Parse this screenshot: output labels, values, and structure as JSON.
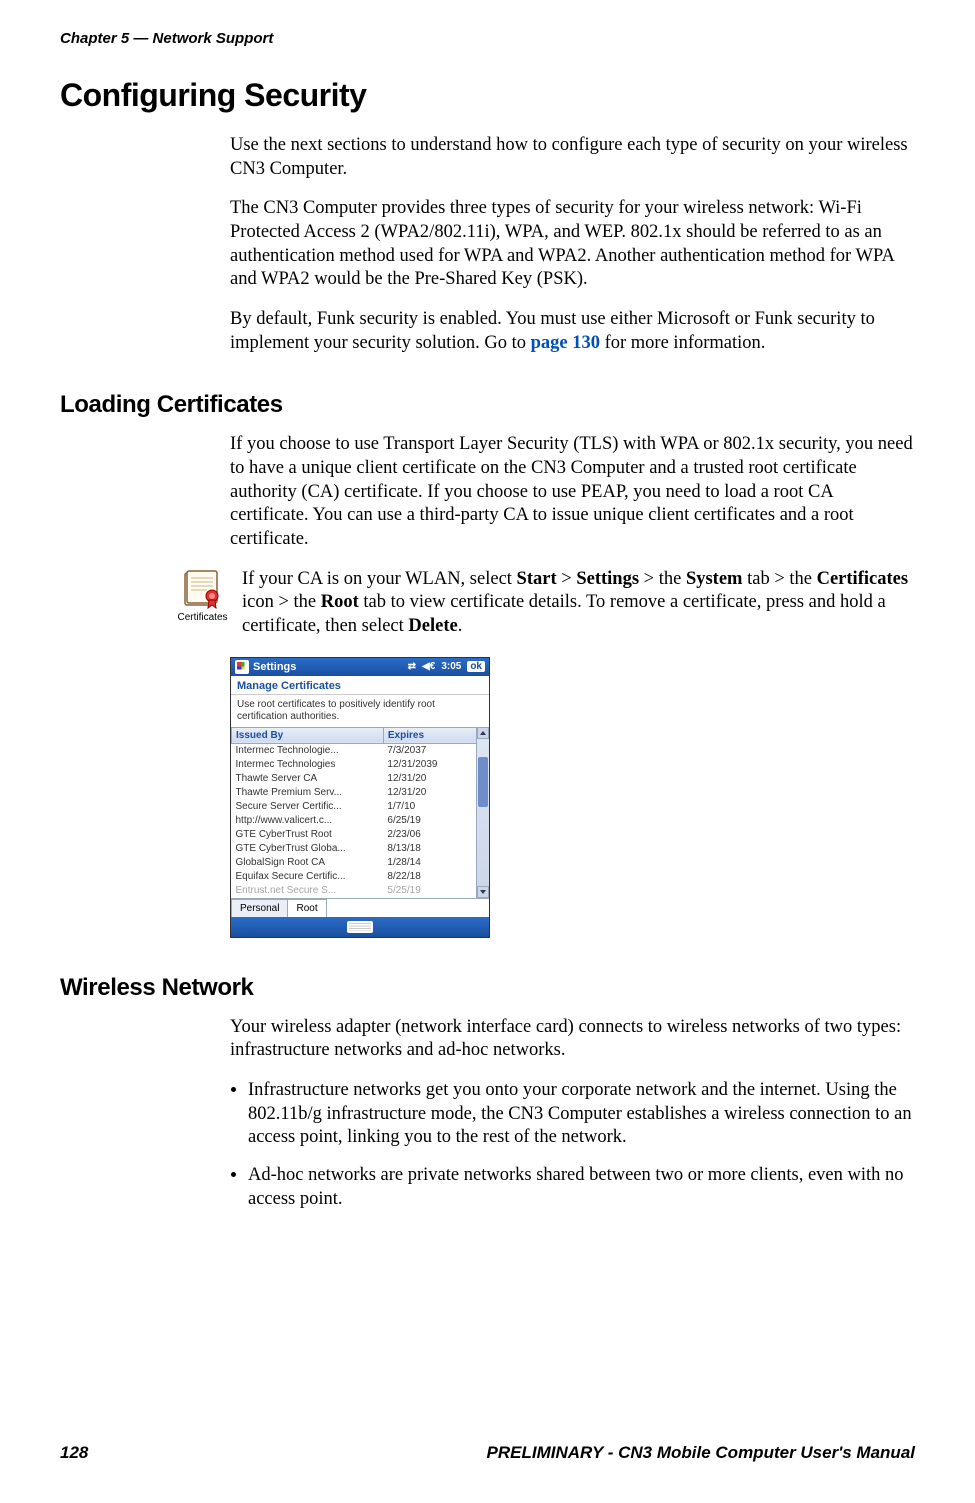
{
  "runningHeader": "Chapter 5 — Network Support",
  "title": "Configuring Security",
  "intro1": "Use the next sections to understand how to configure each type of security on your wireless CN3 Computer.",
  "intro2": "The CN3 Computer provides three types of security for your wireless network: Wi-Fi Protected Access 2 (WPA2/802.11i), WPA, and WEP. 802.1x should be referred to as an authentication method used for WPA and WPA2. Another authentication method for WPA and WPA2 would be the Pre-Shared Key (PSK).",
  "intro3_pre": "By default, Funk security is enabled. You must use either Microsoft or Funk security to implement your security solution. Go to ",
  "intro3_link": "page 130",
  "intro3_post": " for more information.",
  "section_loading": "Loading Certificates",
  "loading_p1": "If you choose to use Transport Layer Security (TLS) with WPA or 802.1x security, you need to have a unique client certificate on the CN3 Computer and a trusted root certificate authority (CA) certificate. If you choose to use PEAP, you need to load a root CA certificate. You can use a third-party CA to issue unique client certificates and a root certificate.",
  "cert_icon_label": "Certificates",
  "loading_p2_parts": {
    "t1": "If your CA is on your WLAN, select ",
    "b1": "Start",
    "t2": " > ",
    "b2": "Settings",
    "t3": " > the ",
    "b3": "System",
    "t4": " tab > the ",
    "b4": "Certificates",
    "t5": " icon > the ",
    "b5": "Root",
    "t6": " tab to view certificate details. To remove a certificate, press and hold a certificate, then select ",
    "b6": "Delete",
    "t7": "."
  },
  "wm": {
    "titlebar": "Settings",
    "tray_time": "3:05",
    "ok": "ok",
    "subtitle": "Manage Certificates",
    "instruction": "Use root certificates to positively identify root certification authorities.",
    "col1": "Issued By",
    "col2": "Expires",
    "rows": [
      {
        "by": "Intermec Technologie...",
        "exp": "7/3/2037"
      },
      {
        "by": "Intermec Technologies",
        "exp": "12/31/2039"
      },
      {
        "by": "Thawte Server CA",
        "exp": "12/31/20"
      },
      {
        "by": "Thawte Premium Serv...",
        "exp": "12/31/20"
      },
      {
        "by": "Secure Server Certific...",
        "exp": "1/7/10"
      },
      {
        "by": "http://www.valicert.c...",
        "exp": "6/25/19"
      },
      {
        "by": "GTE CyberTrust Root",
        "exp": "2/23/06"
      },
      {
        "by": "GTE CyberTrust Globa...",
        "exp": "8/13/18"
      },
      {
        "by": "GlobalSign Root CA",
        "exp": "1/28/14"
      },
      {
        "by": "Equifax Secure Certific...",
        "exp": "8/22/18"
      },
      {
        "by": "Entrust.net Secure S...",
        "exp": "5/25/19"
      }
    ],
    "tab_personal": "Personal",
    "tab_root": "Root"
  },
  "section_wireless": "Wireless Network",
  "wireless_p1": "Your wireless adapter (network interface card) connects to wireless networks of two types: infrastructure networks and ad-hoc networks.",
  "wireless_b1": "Infrastructure networks get you onto your corporate network and the internet. Using the 802.11b/g infrastructure mode, the CN3 Computer establishes a wireless connection to an access point, linking you to the rest of the network.",
  "wireless_b2": "Ad-hoc networks are private networks shared between two or more clients, even with no access point.",
  "footer_page": "128",
  "footer_title": "PRELIMINARY - CN3 Mobile Computer User's Manual"
}
